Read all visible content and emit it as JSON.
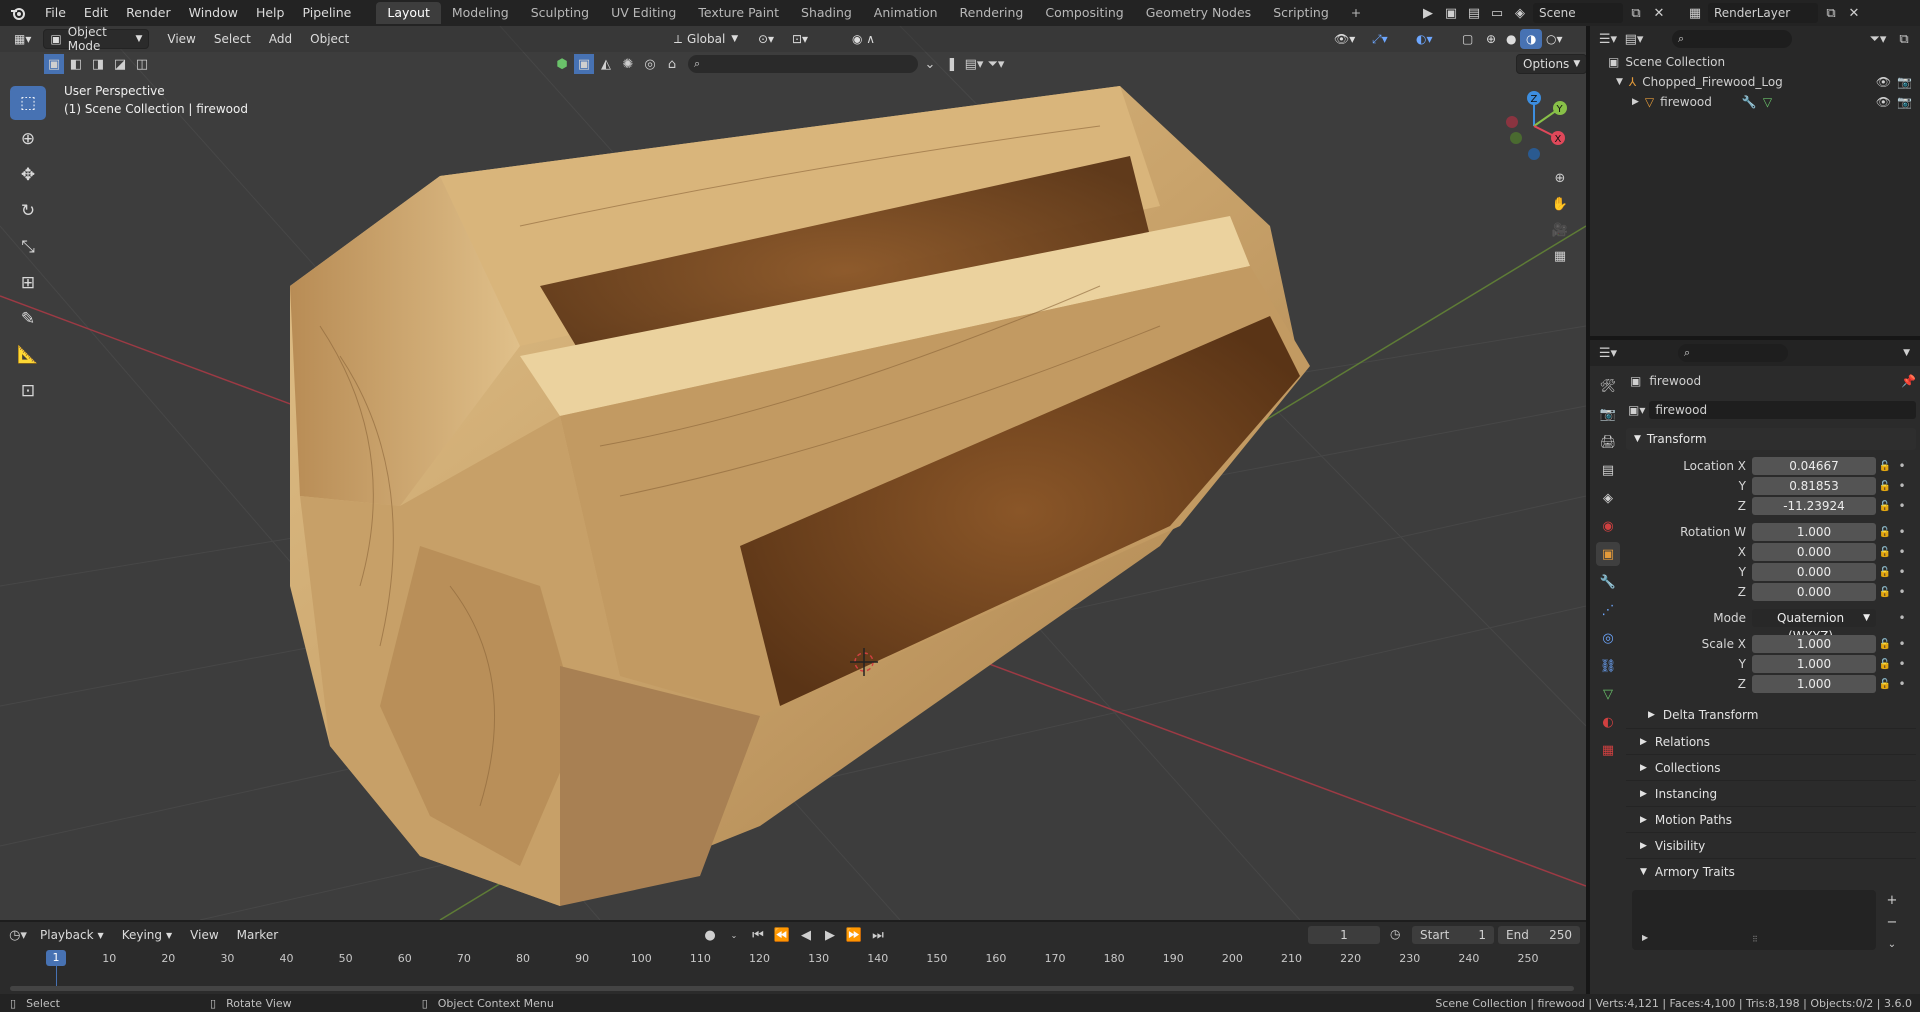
{
  "topbar": {
    "menus": [
      "File",
      "Edit",
      "Render",
      "Window",
      "Help",
      "Pipeline"
    ],
    "workspaces": [
      "Layout",
      "Modeling",
      "Sculpting",
      "UV Editing",
      "Texture Paint",
      "Shading",
      "Animation",
      "Rendering",
      "Compositing",
      "Geometry Nodes",
      "Scripting"
    ],
    "active_workspace": "Layout",
    "add_workspace": "+",
    "scene_name": "Scene",
    "render_layer": "RenderLayer"
  },
  "viewport_header": {
    "mode": "Object Mode",
    "menus": [
      "View",
      "Select",
      "Add",
      "Object"
    ],
    "transform_orientation": "Global",
    "options_label": "Options"
  },
  "viewport": {
    "perspective_label": "User Perspective",
    "collection_label": "(1) Scene Collection | firewood"
  },
  "tools": [
    "select-box",
    "cursor",
    "move",
    "rotate",
    "scale",
    "transform",
    "annotate",
    "measure",
    "add-cube"
  ],
  "gizmo": {
    "z": "Z",
    "y": "Y",
    "x": "X"
  },
  "outliner": {
    "root": "Scene Collection",
    "items": [
      {
        "label": "Chopped_Firewood_Log",
        "icon": "empty-icon"
      },
      {
        "label": "firewood",
        "icon": "mesh-icon"
      }
    ]
  },
  "properties": {
    "object_name": "firewood",
    "object_field": "firewood",
    "transform": {
      "title": "Transform",
      "location_label": "Location X",
      "location": [
        "0.04667",
        "0.81853",
        "-11.23924"
      ],
      "rotation_label": "Rotation W",
      "rotation": [
        "1.000",
        "0.000",
        "0.000",
        "0.000"
      ],
      "mode_label": "Mode",
      "mode": "Quaternion (WXYZ)",
      "scale_label": "Scale X",
      "scale": [
        "1.000",
        "1.000",
        "1.000"
      ],
      "axis_y": "Y",
      "axis_z": "Z",
      "axis_x": "X"
    },
    "subpanels": [
      "Delta Transform",
      "Relations",
      "Collections",
      "Instancing",
      "Motion Paths",
      "Visibility",
      "Armory Traits"
    ]
  },
  "timeline": {
    "menus": [
      "Playback",
      "Keying",
      "View",
      "Marker"
    ],
    "current_frame": "1",
    "start_label": "Start",
    "start": "1",
    "end_label": "End",
    "end": "250",
    "ticks": [
      "1",
      "10",
      "20",
      "30",
      "40",
      "50",
      "60",
      "70",
      "80",
      "90",
      "100",
      "110",
      "120",
      "130",
      "140",
      "150",
      "160",
      "170",
      "180",
      "190",
      "200",
      "210",
      "220",
      "230",
      "240",
      "250"
    ]
  },
  "statusbar": {
    "left_hint": "Select",
    "middle_hint": "Rotate View",
    "right_hint": "Object Context Menu",
    "stats": "Scene Collection | firewood | Verts:4,121 | Faces:4,100 | Tris:8,198 | Objects:0/2 | 3.6.0"
  },
  "colors": {
    "accent": "#4772b3",
    "x_axis": "#e0485a",
    "y_axis": "#88c048",
    "z_axis": "#3d8ee0",
    "wood": "#c9a36b",
    "bark": "#7a4a22"
  }
}
